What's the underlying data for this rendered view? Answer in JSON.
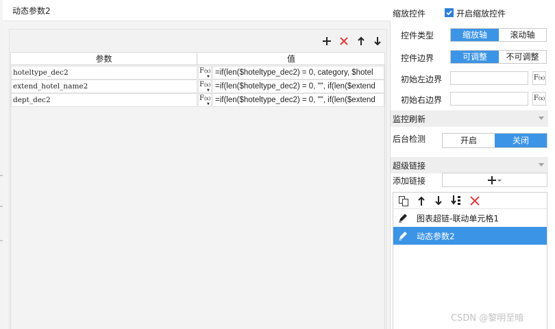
{
  "dialog": {
    "title": "动态参数2",
    "table": {
      "columns": [
        "参数",
        "值"
      ],
      "rows": [
        {
          "name": "hoteltype_dec2",
          "fx": "F",
          "fx_sub": "(x)",
          "value": "=if(len($hoteltype_dec2) = 0, category, $hotel"
        },
        {
          "name": "extend_hotel_name2",
          "fx": "F",
          "fx_sub": "(x)",
          "value": "=if(len($hoteltype_dec2) = 0, \"\", if(len($extend"
        },
        {
          "name": "dept_dec2",
          "fx": "F",
          "fx_sub": "(x)",
          "value": "=if(len($hoteltype_dec2) = 0, \"\", if(len($extend"
        }
      ]
    }
  },
  "zoom": {
    "section_label": "缩放控件",
    "enable_label": "开启缩放控件",
    "enable_checked": true,
    "type_label": "控件类型",
    "type_options": [
      "缩放轴",
      "滚动轴"
    ],
    "type_selected": "缩放轴",
    "boundary_label": "控件边界",
    "boundary_options": [
      "可调整",
      "不可调整"
    ],
    "boundary_selected": "可调整",
    "left_boundary_label": "初始左边界",
    "right_boundary_label": "初始右边界",
    "left_value": "",
    "right_value": ""
  },
  "monitor": {
    "title": "监控刷新",
    "bg_check_label": "后台检测",
    "options": [
      "开启",
      "关闭"
    ],
    "selected": "关闭"
  },
  "hyperlink": {
    "title": "超级链接",
    "add_label": "添加链接",
    "items": [
      {
        "label": "图表超链-联动单元格1",
        "selected": false
      },
      {
        "label": "动态参数2",
        "selected": true
      }
    ]
  },
  "watermark": "CSDN @黎明至暗",
  "colors": {
    "accent": "#3c94e6",
    "delete": "#e03a3a"
  }
}
